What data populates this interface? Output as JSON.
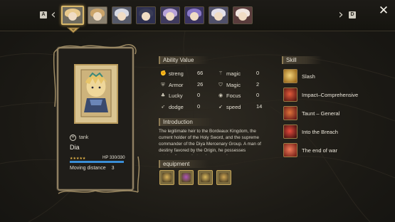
{
  "topbar": {
    "left_key": "A",
    "right_key": "D",
    "prev_icon": "chevron-left-icon",
    "next_icon": "chevron-right-icon",
    "close_icon": "close-icon",
    "close_glyph": "✕",
    "prev_glyph": "‹",
    "next_glyph": "›",
    "portraits": [
      {
        "id": "dia",
        "hair": "#e8c98c",
        "bg": "#6e6a5e",
        "active": true
      },
      {
        "id": "hero-2",
        "hair": "#cba46a",
        "bg": "#8a8170",
        "active": false
      },
      {
        "id": "hero-3",
        "hair": "#d7d9e3",
        "bg": "#565a6a",
        "active": false
      },
      {
        "id": "hero-4",
        "hair": "#3a3c57",
        "bg": "#2e3050",
        "active": false
      },
      {
        "id": "hero-5",
        "hair": "#b7a2d8",
        "bg": "#3f3a5e",
        "active": false
      },
      {
        "id": "hero-6",
        "hair": "#8a78c8",
        "bg": "#3a3360",
        "active": false
      },
      {
        "id": "hero-7",
        "hair": "#e4e0ea",
        "bg": "#50506a",
        "active": false
      },
      {
        "id": "hero-8",
        "hair": "#f1e6e0",
        "bg": "#5a3c3c",
        "active": false
      }
    ]
  },
  "character": {
    "role": "tank",
    "name": "Dia",
    "stars": "★★★★★",
    "hp_label": "HP  330/330",
    "hp_fraction": 1.0,
    "move_label": "Moving distance",
    "move_value": "3"
  },
  "ability": {
    "title": "Ability Value",
    "left": [
      {
        "label": "streng",
        "value": "66",
        "icon": "sword-strength-icon",
        "glyph": "✊"
      },
      {
        "label": "Armor",
        "value": "26",
        "icon": "shield-icon",
        "glyph": "⛨"
      },
      {
        "label": "Lucky",
        "value": "0",
        "icon": "clover-icon",
        "glyph": "♣"
      },
      {
        "label": "dodge",
        "value": "0",
        "icon": "boot-icon",
        "glyph": "➶"
      }
    ],
    "right": [
      {
        "label": "magic",
        "value": "0",
        "icon": "magic-staff-icon",
        "glyph": "⚚"
      },
      {
        "label": "Magic",
        "value": "2",
        "icon": "magic-shield-icon",
        "glyph": "⛉"
      },
      {
        "label": "Focus",
        "value": "0",
        "icon": "focus-eye-icon",
        "glyph": "◉"
      },
      {
        "label": "speed",
        "value": "14",
        "icon": "wing-icon",
        "glyph": "➹"
      }
    ]
  },
  "introduction": {
    "title": "Introduction",
    "text": "The legitimate heir to the Bordeaux Kingdom, the current holder of the Holy Sword, and the supreme commander of the Diya Mercenary Group. A man of destiny favored by the Origin, he possesses outstanding combat and command"
  },
  "equipment": {
    "title": "equipment",
    "items": [
      {
        "icon": "sword-equip-icon",
        "color": "#d9b35a"
      },
      {
        "icon": "cloak-equip-icon",
        "color": "#b055b8"
      },
      {
        "icon": "helmet-equip-icon",
        "color": "#d8b75c"
      },
      {
        "icon": "ring-equip-icon",
        "color": "#cfa653"
      }
    ]
  },
  "skills": {
    "title": "Skill",
    "items": [
      {
        "label": "Slash",
        "icon": "slash-skill-icon",
        "c1": "#f2d27a",
        "c2": "#9a6a1c"
      },
      {
        "label": "Impact–Comprehensive",
        "icon": "impact-skill-icon",
        "c1": "#e25a3a",
        "c2": "#5c1a14"
      },
      {
        "label": "Taunt – General",
        "icon": "taunt-skill-icon",
        "c1": "#e0743a",
        "c2": "#6a1c1a"
      },
      {
        "label": "Into the Breach",
        "icon": "breach-skill-icon",
        "c1": "#e64a3c",
        "c2": "#4a1412"
      },
      {
        "label": "The end of war",
        "icon": "end-of-war-skill-icon",
        "c1": "#f07a5a",
        "c2": "#7a2418"
      }
    ]
  }
}
